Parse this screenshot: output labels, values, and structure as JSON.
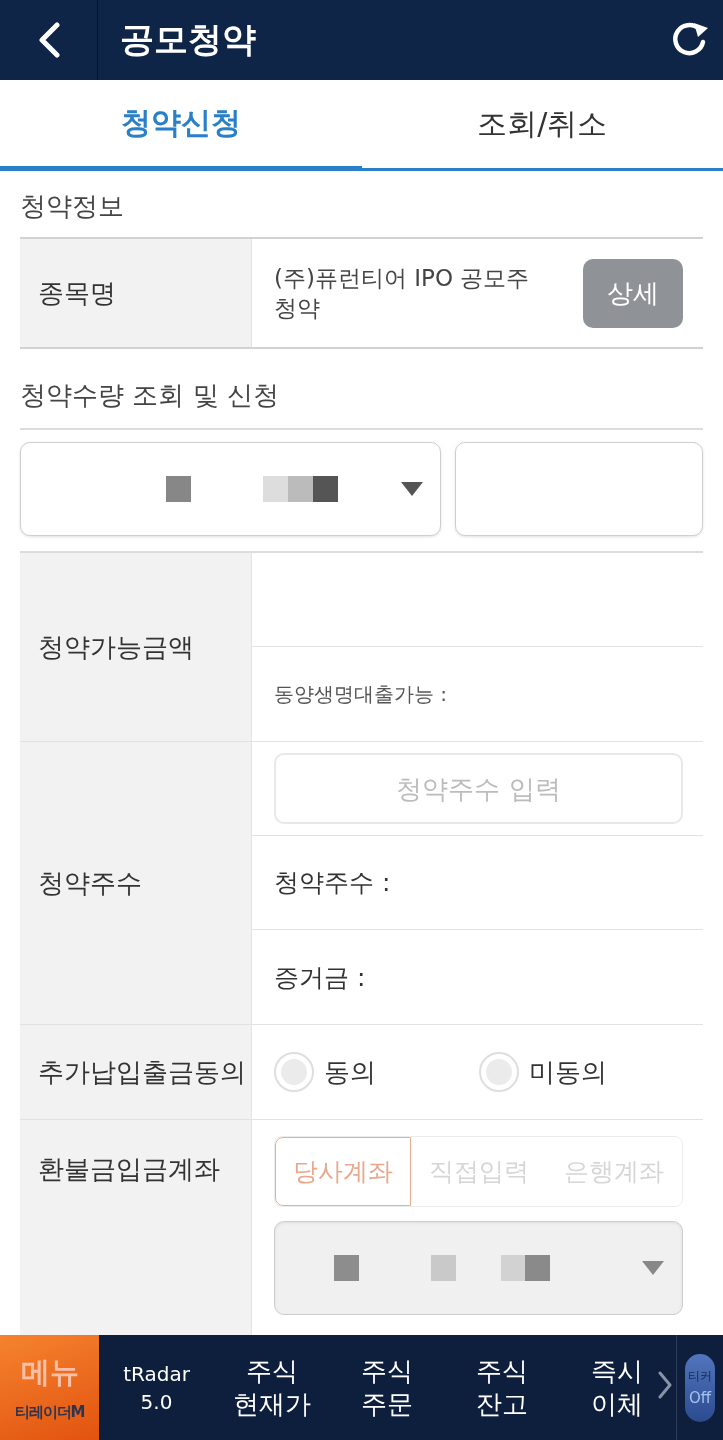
{
  "header": {
    "title": "공모청약"
  },
  "tabs": [
    {
      "label": "청약신청",
      "selected": true
    },
    {
      "label": "조회/취소",
      "selected": false
    }
  ],
  "info": {
    "heading": "청약정보",
    "label": "종목명",
    "value": "(주)퓨런티어 IPO 공모주 청약",
    "button": "상세"
  },
  "quantity": {
    "heading": "청약수량 조회 및 신청"
  },
  "rows": [
    {
      "kind": "amount",
      "label": "청약가능금액",
      "note": "동양생명대출가능 :"
    },
    {
      "kind": "shares",
      "label": "청약주수",
      "placeholder": "청약주수 입력",
      "lines": [
        "청약주수 :",
        "증거금 :"
      ]
    },
    {
      "kind": "radio",
      "label": "추가납입출금동의",
      "options": [
        {
          "label": "동의",
          "selected": false
        },
        {
          "label": "미동의",
          "selected": false
        }
      ]
    },
    {
      "kind": "account",
      "label": "환불금입금계좌",
      "disabled": true,
      "segments": [
        {
          "label": "당사계좌",
          "selected": true
        },
        {
          "label": "직접입력",
          "selected": false
        },
        {
          "label": "은행계좌",
          "selected": false
        }
      ]
    }
  ],
  "bottom_nav": {
    "menu": {
      "label": "메뉴",
      "logo": "티레이더M"
    },
    "items": [
      {
        "kind": "small",
        "lines": [
          "tRadar",
          "5.0"
        ]
      },
      {
        "kind": "normal",
        "lines": [
          "주식",
          "현재가"
        ]
      },
      {
        "kind": "normal",
        "lines": [
          "주식",
          "주문"
        ]
      },
      {
        "kind": "normal",
        "lines": [
          "주식",
          "잔고"
        ]
      },
      {
        "kind": "normal",
        "lines": [
          "즉시",
          "이체"
        ]
      }
    ],
    "ticker": {
      "label": "티커",
      "status": "Off",
      "on": false
    }
  }
}
